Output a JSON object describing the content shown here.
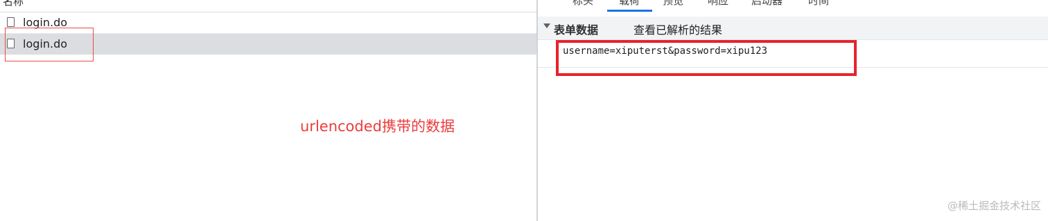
{
  "network_list": {
    "column_header": "名称",
    "rows": [
      {
        "name": "login.do"
      },
      {
        "name": "login.do"
      }
    ]
  },
  "annotation": "urlencoded携带的数据",
  "details": {
    "tabs": [
      {
        "label": "标头"
      },
      {
        "label": "载荷"
      },
      {
        "label": "预览"
      },
      {
        "label": "响应"
      },
      {
        "label": "启动器"
      },
      {
        "label": "时间"
      }
    ],
    "active_tab": "载荷",
    "section": {
      "title": "表单数据",
      "view_parsed_label": "查看已解析的结果",
      "payload": "username=xiputerst&password=xipu123"
    }
  },
  "watermark": "@稀土掘金技术社区",
  "colors": {
    "highlight_red": "#e8222c",
    "annotation_red": "#ec3b3b",
    "tab_underline_blue": "#1a73e8",
    "selected_row_gray": "#dcdde0"
  }
}
